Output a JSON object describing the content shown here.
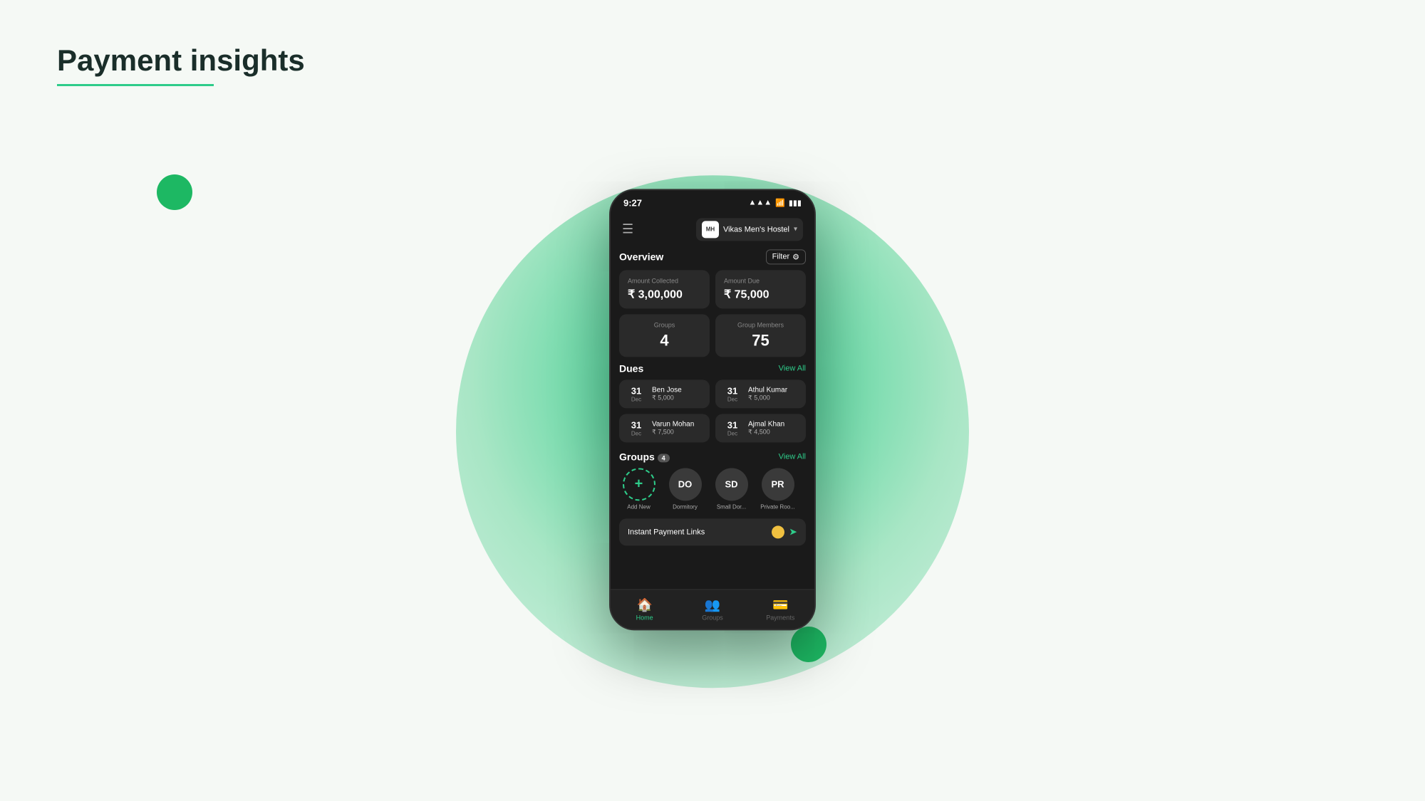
{
  "page": {
    "title": "Payment insights",
    "title_underline_color": "#2ecc8a"
  },
  "phone": {
    "status_bar": {
      "time": "9:27",
      "signal": "▲▲▲",
      "wifi": "wifi",
      "battery": "battery"
    },
    "nav": {
      "hostel_avatar": "MH",
      "hostel_name": "Vikas Men's Hostel",
      "hostel_chevron": "▾"
    },
    "overview": {
      "title": "Overview",
      "filter_label": "Filter",
      "amount_collected_label": "Amount Collected",
      "amount_collected_value": "₹ 3,00,000",
      "amount_due_label": "Amount Due",
      "amount_due_value": "₹ 75,000",
      "groups_label": "Groups",
      "groups_value": "4",
      "group_members_label": "Group Members",
      "group_members_value": "75"
    },
    "dues": {
      "title": "Dues",
      "view_all": "View All",
      "items": [
        {
          "date_num": "31",
          "date_month": "Dec",
          "name": "Ben Jose",
          "amount": "₹ 5,000"
        },
        {
          "date_num": "31",
          "date_month": "Dec",
          "name": "Athul Kumar",
          "amount": "₹ 5,000"
        },
        {
          "date_num": "31",
          "date_month": "Dec",
          "name": "Varun Mohan",
          "amount": "₹ 7,500"
        },
        {
          "date_num": "31",
          "date_month": "Dec",
          "name": "Ajmal Khan",
          "amount": "₹ 4,500"
        }
      ]
    },
    "groups": {
      "title": "Groups",
      "count": "4",
      "view_all": "View All",
      "items": [
        {
          "label": "Add New",
          "initials": "+",
          "is_add": true
        },
        {
          "label": "Dormitory",
          "initials": "DO"
        },
        {
          "label": "Small Dor...",
          "initials": "SD"
        },
        {
          "label": "Private Roo...",
          "initials": "PR"
        }
      ]
    },
    "instant_payment": {
      "title": "Instant Payment Links"
    },
    "bottom_nav": [
      {
        "label": "Home",
        "icon": "🏠",
        "active": true
      },
      {
        "label": "Groups",
        "icon": "👥",
        "active": false
      },
      {
        "label": "Payments",
        "icon": "💳",
        "active": false
      }
    ]
  }
}
